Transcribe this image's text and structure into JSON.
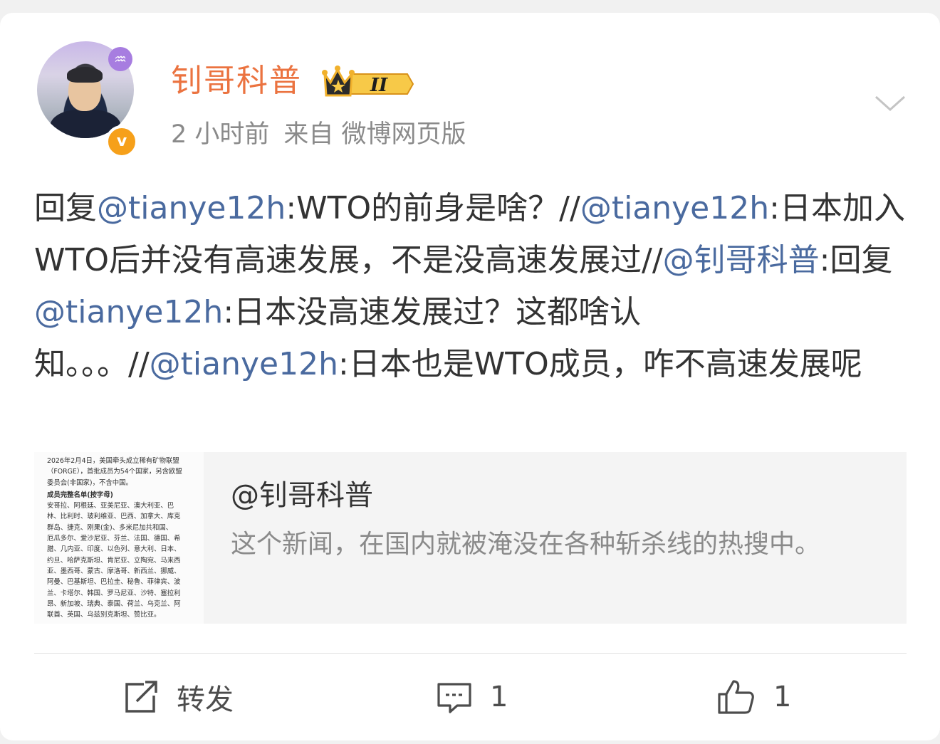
{
  "post": {
    "author": "钊哥科普",
    "member_level": "II",
    "time": "2 小时前",
    "source": "来自 微博网页版",
    "content": [
      {
        "text": "回复",
        "mention": false
      },
      {
        "text": "@tianye12h",
        "mention": true
      },
      {
        "text": ":WTO的前身是啥？//",
        "mention": false
      },
      {
        "text": "@tianye12h",
        "mention": true
      },
      {
        "text": ":日本加入WTO后并没有高速发展，不是没高速发展过//",
        "mention": false
      },
      {
        "text": "@钊哥科普",
        "mention": true
      },
      {
        "text": ":回复",
        "mention": false
      },
      {
        "text": "@tianye12h",
        "mention": true
      },
      {
        "text": ":日本没高速发展过？这都啥认知。。。//",
        "mention": false
      },
      {
        "text": "@tianye12h",
        "mention": true
      },
      {
        "text": ":日本也是WTO成员，咋不高速发展呢",
        "mention": false
      }
    ]
  },
  "quoted": {
    "author": "@钊哥科普",
    "text": "这个新闻，在国内就被淹没在各种斩杀线的热搜中。",
    "thumbnail_lines": [
      "2026年2月4日，美国牵头成立稀有矿物联盟",
      "（FORGE），首批成员为54个国家，另含欧盟",
      "委员会(非国家)，不含中国。",
      "成员完整名单(按字母)",
      "安哥拉、阿根廷、亚美尼亚、澳大利亚、巴",
      "林、比利时、玻利维亚、巴西、加拿大、库克",
      "群岛、捷克、刚果(金)、多米尼加共和国、",
      "厄瓜多尔、爱沙尼亚、芬兰、法国、德国、希",
      "腊、几内亚、印度、以色列、意大利、日本、",
      "约旦、哈萨克斯坦、肯尼亚、立陶宛、马来西",
      "亚、墨西哥、蒙古、摩洛哥、新西兰、挪威、",
      "阿曼、巴基斯坦、巴拉圭、秘鲁、菲律宾、波",
      "兰、卡塔尔、韩国、罗马尼亚、沙特、塞拉利",
      "昂、新加坡、瑞典、泰国、荷兰、乌克兰、阿",
      "联酋、英国、乌兹别克斯坦、赞比亚。"
    ]
  },
  "actions": {
    "repost_label": "转发",
    "comment_count": "1",
    "like_count": "1"
  },
  "colors": {
    "username": "#eb7340",
    "mention": "#4a6a9f",
    "secondary": "#8a8a8a",
    "badge": "#f6a01a"
  },
  "icons": [
    "verified-icon",
    "crown-badge-icon",
    "chevron-down-icon",
    "repost-icon",
    "comment-icon",
    "like-icon"
  ]
}
